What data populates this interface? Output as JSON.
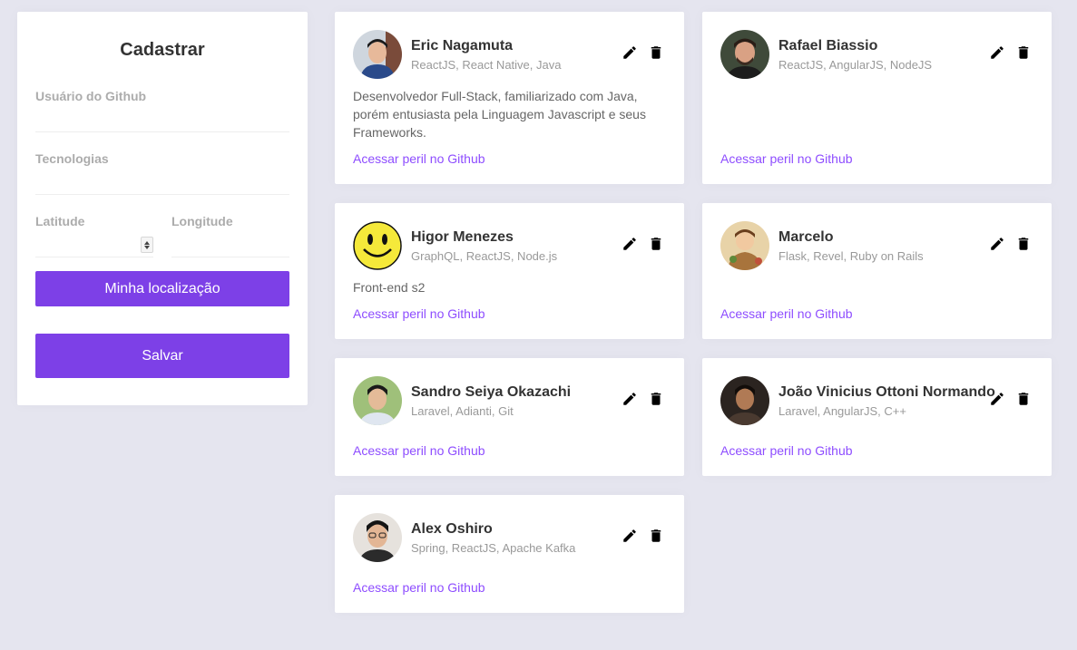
{
  "form": {
    "title": "Cadastrar",
    "github_user_label": "Usuário do Github",
    "github_user_value": "",
    "techs_label": "Tecnologias",
    "techs_value": "",
    "latitude_label": "Latitude",
    "latitude_value": "",
    "longitude_label": "Longitude",
    "longitude_value": "",
    "location_button": "Minha localização",
    "save_button": "Salvar"
  },
  "cards": [
    {
      "name": "Eric Nagamuta",
      "techs": "ReactJS, React Native, Java",
      "bio": "Desenvolvedor Full-Stack, familiarizado com Java, porém entusiasta pela Linguagem Javascript e seus Frameworks.",
      "link": "Acessar peril no Github"
    },
    {
      "name": "Rafael Biassio",
      "techs": "ReactJS, AngularJS, NodeJS",
      "bio": "",
      "link": "Acessar peril no Github"
    },
    {
      "name": "Higor Menezes",
      "techs": "GraphQL, ReactJS, Node.js",
      "bio": "Front-end s2",
      "link": "Acessar peril no Github"
    },
    {
      "name": "Marcelo",
      "techs": "Flask, Revel, Ruby on Rails",
      "bio": "",
      "link": "Acessar peril no Github"
    },
    {
      "name": "Sandro Seiya Okazachi",
      "techs": "Laravel, Adianti, Git",
      "bio": "",
      "link": "Acessar peril no Github"
    },
    {
      "name": "João Vinicius Ottoni Normando",
      "techs": "Laravel, AngularJS, C++",
      "bio": "",
      "link": "Acessar peril no Github"
    },
    {
      "name": "Alex Oshiro",
      "techs": "Spring, ReactJS, Apache Kafka",
      "bio": "",
      "link": "Acessar peril no Github"
    }
  ],
  "colors": {
    "background": "#e5e5ef",
    "primary": "#7d40e7",
    "link": "#8e4dff"
  },
  "icons": {
    "edit": "pencil-icon",
    "delete": "trash-icon"
  }
}
